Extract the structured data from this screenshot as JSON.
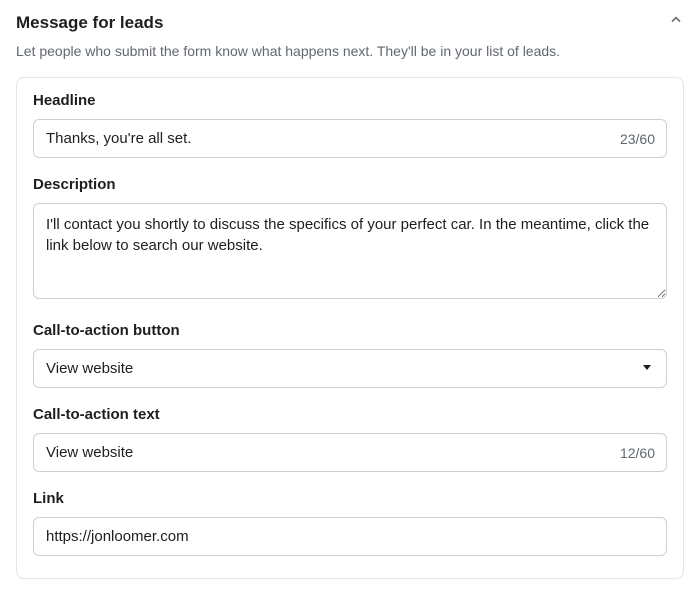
{
  "section": {
    "title": "Message for leads",
    "description": "Let people who submit the form know what happens next. They'll be in your list of leads."
  },
  "fields": {
    "headline": {
      "label": "Headline",
      "value": "Thanks, you're all set.",
      "count": "23/60"
    },
    "description": {
      "label": "Description",
      "value": "I'll contact you shortly to discuss the specifics of your perfect car. In the meantime, click the link below to search our website."
    },
    "cta_button": {
      "label": "Call-to-action button",
      "value": "View website"
    },
    "cta_text": {
      "label": "Call-to-action text",
      "value": "View website",
      "count": "12/60"
    },
    "link": {
      "label": "Link",
      "value": "https://jonloomer.com"
    }
  }
}
